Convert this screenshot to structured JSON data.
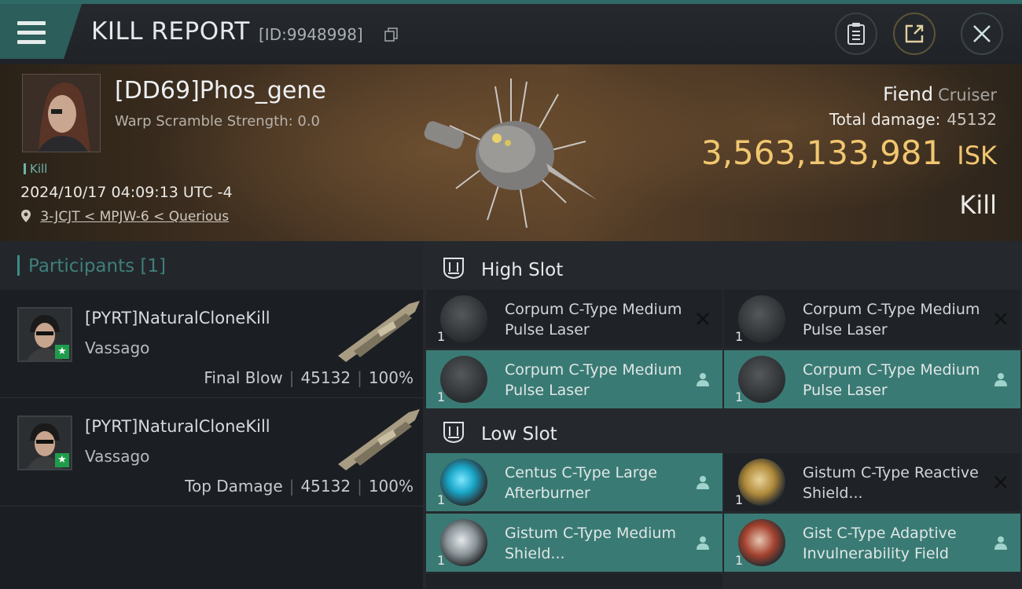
{
  "header": {
    "title": "KILL REPORT",
    "report_id": "[ID:9948998]"
  },
  "victim": {
    "name": "[DD69]Phos_gene",
    "warp_scramble": "Warp Scramble Strength: 0.0",
    "tag": "Kill",
    "datetime": "2024/10/17 04:09:13 UTC -4",
    "location": "3-JCJT < MPJW-6 < Querious",
    "ship_name": "Fiend",
    "ship_class": "Cruiser",
    "total_damage_label": "Total damage:",
    "total_damage": "45132",
    "isk_value": "3,563,133,981",
    "isk_unit": "ISK",
    "result": "Kill"
  },
  "participants": {
    "title": "Participants [1]",
    "rows": [
      {
        "name": "[PYRT]NaturalCloneKill",
        "ship": "Vassago",
        "role": "Final Blow",
        "damage": "45132",
        "percent": "100%"
      },
      {
        "name": "[PYRT]NaturalCloneKill",
        "ship": "Vassago",
        "role": "Top Damage",
        "damage": "45132",
        "percent": "100%"
      }
    ]
  },
  "fitting": {
    "high_slot_label": "High Slot",
    "low_slot_label": "Low Slot",
    "high": [
      {
        "qty": "1",
        "name": "Corpum C-Type Medium Pulse Laser",
        "state": "destroyed",
        "icon": "pulse-laser-icon"
      },
      {
        "qty": "1",
        "name": "Corpum C-Type Medium Pulse Laser",
        "state": "destroyed",
        "icon": "pulse-laser-icon"
      },
      {
        "qty": "1",
        "name": "Corpum C-Type Medium Pulse Laser",
        "state": "dropped",
        "icon": "pulse-laser-icon"
      },
      {
        "qty": "1",
        "name": "Corpum C-Type Medium Pulse Laser",
        "state": "dropped",
        "icon": "pulse-laser-icon"
      }
    ],
    "low": [
      {
        "qty": "1",
        "name": "Centus C-Type Large Afterburner",
        "state": "dropped",
        "icon": "afterburner-icon"
      },
      {
        "qty": "1",
        "name": "Gistum C-Type Reactive Shield...",
        "state": "destroyed",
        "icon": "shield-icon"
      },
      {
        "qty": "1",
        "name": "Gistum C-Type Medium Shield...",
        "state": "dropped",
        "icon": "shield-icon"
      },
      {
        "qty": "1",
        "name": "Gist C-Type Adaptive Invulnerability Field",
        "state": "dropped",
        "icon": "shield-red-icon"
      }
    ]
  },
  "colors": {
    "accent_teal": "#3a7a74",
    "isk_gold": "#f1c66f"
  }
}
